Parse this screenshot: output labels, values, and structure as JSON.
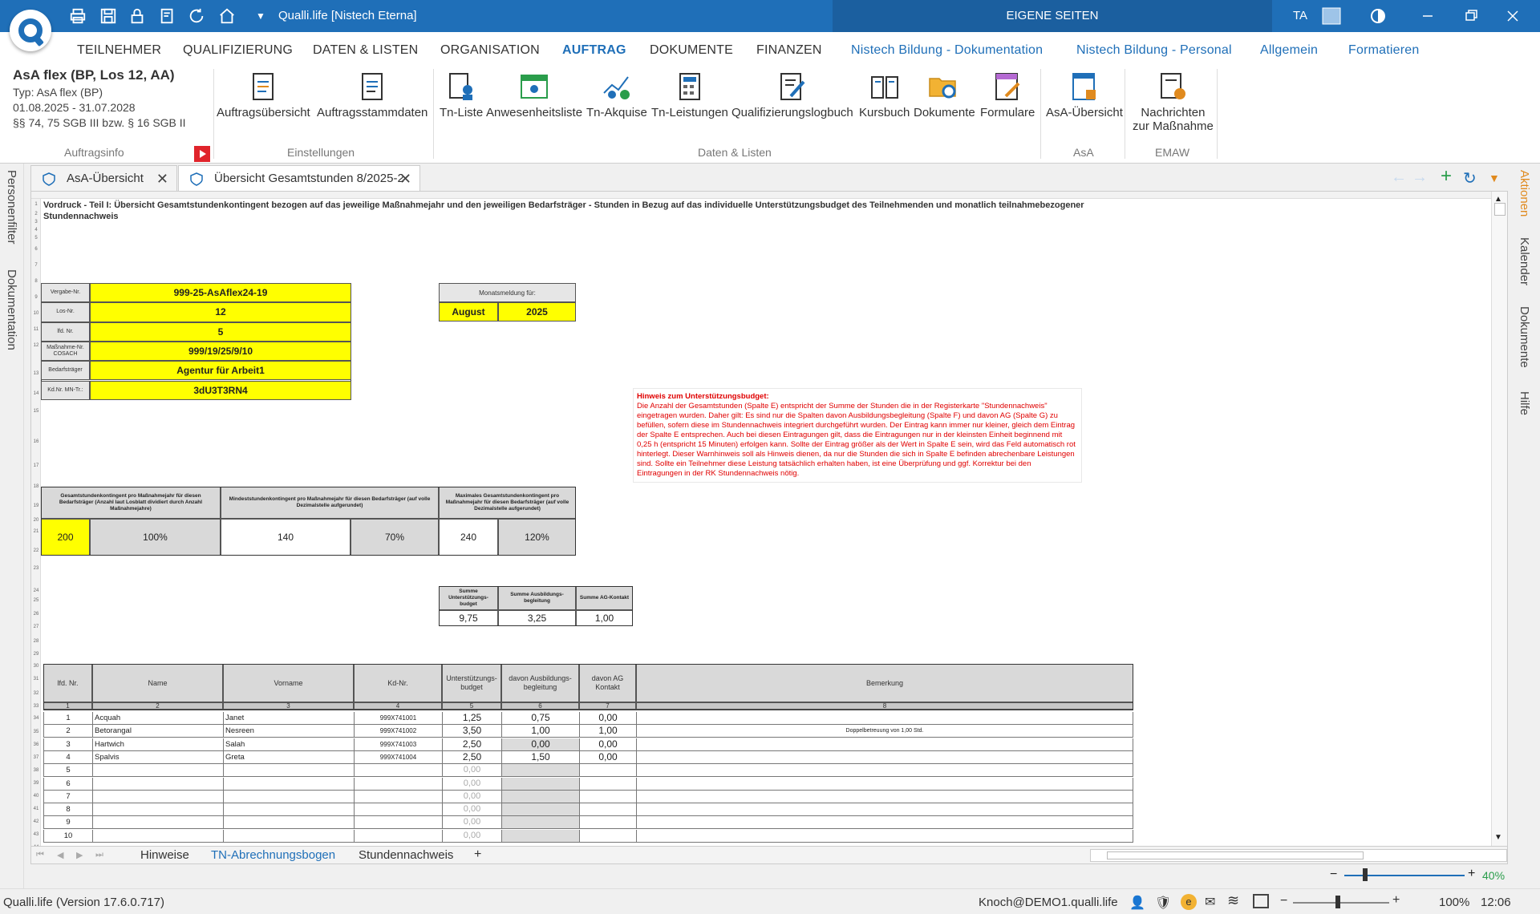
{
  "window": {
    "title": "Qualli.life [Nistech Eterna]",
    "eigene_seiten": "EIGENE SEITEN",
    "ta": "TA"
  },
  "ribbon_tabs": [
    "TEILNEHMER",
    "QUALIFIZIERUNG",
    "DATEN & LISTEN",
    "ORGANISATION",
    "AUFTRAG",
    "DOKUMENTE",
    "FINANZEN",
    "Nistech Bildung - Dokumentation",
    "Nistech Bildung - Personal",
    "Allgemein",
    "Formatieren"
  ],
  "auftragsinfo": {
    "title": "AsA flex (BP, Los 12, AA)",
    "typ": "Typ: AsA flex (BP)",
    "zeitraum": "01.08.2025 - 31.07.2028",
    "paragraph": "§§ 74, 75 SGB III bzw. § 16 SGB II",
    "group_label": "Auftragsinfo"
  },
  "groups": {
    "einstellungen": "Einstellungen",
    "daten_listen": "Daten & Listen",
    "asa": "AsA",
    "emaw": "EMAW"
  },
  "ribbon_buttons": {
    "auftragsuebersicht": "Auftragsübersicht",
    "auftragsstammdaten": "Auftragsstammdaten",
    "tn_liste": "Tn-Liste",
    "anwesenheitsliste": "Anwesenheitsliste",
    "tn_akquise": "Tn-Akquise",
    "tn_leistungen": "Tn-Leistungen",
    "qualifizierungslogbuch": "Qualifizierungslogbuch",
    "kursbuch": "Kursbuch",
    "dokumente": "Dokumente",
    "formulare": "Formulare",
    "asa_uebersicht": "AsA-Übersicht",
    "nachrichten_1": "Nachrichten",
    "nachrichten_2": "zur Maßnahme"
  },
  "left_panel": [
    "Personenfilter",
    "Dokumentation"
  ],
  "right_panel": [
    "Aktionen",
    "Kalender",
    "Dokumente",
    "Hilfe"
  ],
  "doc_tabs": [
    "AsA-Übersicht",
    "Übersicht Gesamtstunden 8/2025-2"
  ],
  "sheet": {
    "heading": "Vordruck - Teil I: Übersicht Gesamtstundenkontingent bezogen auf das jeweilige Maßnahmejahr und den jeweiligen Bedarfsträger - Stunden in Bezug auf das individuelle Unterstützungsbudget des Teilnehmenden und monatlich teilnahmebezogener Stundennachweis",
    "info_table": [
      {
        "label": "Vergabe-Nr.",
        "value": "999-25-AsAflex24-19"
      },
      {
        "label": "Los-Nr.",
        "value": "12"
      },
      {
        "label": "lfd. Nr.",
        "value": "5"
      },
      {
        "label": "Maßnahme-Nr. COSACH",
        "value": "999/19/25/9/10"
      },
      {
        "label": "Bedarfsträger",
        "value": "Agentur für Arbeit1"
      },
      {
        "label": "Kd.Nr. MN-Tr.:",
        "value": "3dU3T3RN4"
      }
    ],
    "monatsmeldung": {
      "label": "Monatsmeldung für:",
      "month": "August",
      "year": "2025"
    },
    "kontingent": {
      "h1": "Gesamtstundenkontingent pro Maßnahmejahr für diesen Bedarfsträger (Anzahl laut Losblatt dividiert durch Anzahl Maßnahmejahre)",
      "h2": "Mindeststundenkontingent pro Maßnahmejahr für diesen Bedarfsträger (auf volle Dezimalstelle aufgerundet)",
      "h3": "Maximales Gesamtstundenkontingent pro Maßnahmejahr für diesen Bedarfsträger (auf volle Dezimalstelle aufgerundet)",
      "v1": "200",
      "p1": "100%",
      "v2": "140",
      "p2": "70%",
      "v3": "240",
      "p3": "120%"
    },
    "summen": {
      "h1": "Summe Unterstützungs-budget",
      "h2": "Summe Ausbildungs-begleitung",
      "h3": "Summe AG-Kontakt",
      "v1": "9,75",
      "v2": "3,25",
      "v3": "1,00"
    },
    "hinweis": {
      "title": "Hinweis zum Unterstützungsbudget:",
      "text": "Die Anzahl der Gesamtstunden (Spalte E) entspricht der Summe der Stunden die in der Registerkarte \"Stundennachweis\" eingetragen wurden. Daher gilt: Es sind nur die Spalten davon Ausbildungsbegleitung (Spalte F) und davon AG (Spalte G) zu befüllen, sofern diese im Stundennachweis integriert durchgeführt wurden. Der Eintrag kann immer nur kleiner, gleich dem Eintrag der Spalte E entsprechen. Auch bei diesen Eintragungen gilt, dass die Eintragungen nur in der kleinsten Einheit beginnend mit 0,25 h (entspricht 15 Minuten) erfolgen kann. Sollte der Eintrag größer als der Wert in Spalte E sein, wird das Feld automatisch rot hinterlegt. Dieser Warnhinweis soll als Hinweis dienen, da nur die Stunden die sich in Spalte E befinden abrechenbare Leistungen sind. Sollte ein Teilnehmer diese Leistung tatsächlich erhalten haben, ist eine Überprüfung und ggf. Korrektur bei den Eintragungen in der RK Stundennachweis nötig."
    },
    "table": {
      "headers": [
        "lfd. Nr.",
        "Name",
        "Vorname",
        "Kd-Nr.",
        "Unterstützungs-budget",
        "davon Ausbildungs-begleitung",
        "davon AG Kontakt",
        "Bemerkung"
      ],
      "numbers": [
        "1",
        "2",
        "3",
        "4",
        "5",
        "6",
        "7",
        "8"
      ],
      "rows": [
        {
          "nr": "1",
          "name": "Acquah",
          "vorname": "Janet",
          "kd": "999X741001",
          "ub": "1,25",
          "ab": "0,75",
          "ag": "0,00",
          "bem": ""
        },
        {
          "nr": "2",
          "name": "Betorangal",
          "vorname": "Nesreen",
          "kd": "999X741002",
          "ub": "3,50",
          "ab": "1,00",
          "ag": "1,00",
          "bem": "Doppelbetreuung von 1,00 Std."
        },
        {
          "nr": "3",
          "name": "Hartwich",
          "vorname": "Salah",
          "kd": "999X741003",
          "ub": "2,50",
          "ab": "0,00",
          "ag": "0,00",
          "bem": ""
        },
        {
          "nr": "4",
          "name": "Spalvis",
          "vorname": "Greta",
          "kd": "999X741004",
          "ub": "2,50",
          "ab": "1,50",
          "ag": "0,00",
          "bem": ""
        },
        {
          "nr": "5",
          "name": "",
          "vorname": "",
          "kd": "",
          "ub": "0,00",
          "ab": "",
          "ag": "",
          "bem": ""
        },
        {
          "nr": "6",
          "name": "",
          "vorname": "",
          "kd": "",
          "ub": "0,00",
          "ab": "",
          "ag": "",
          "bem": ""
        },
        {
          "nr": "7",
          "name": "",
          "vorname": "",
          "kd": "",
          "ub": "0,00",
          "ab": "",
          "ag": "",
          "bem": ""
        },
        {
          "nr": "8",
          "name": "",
          "vorname": "",
          "kd": "",
          "ub": "0,00",
          "ab": "",
          "ag": "",
          "bem": ""
        },
        {
          "nr": "9",
          "name": "",
          "vorname": "",
          "kd": "",
          "ub": "0,00",
          "ab": "",
          "ag": "",
          "bem": ""
        },
        {
          "nr": "10",
          "name": "",
          "vorname": "",
          "kd": "",
          "ub": "0,00",
          "ab": "",
          "ag": "",
          "bem": ""
        }
      ]
    }
  },
  "sheet_tabs": [
    "Hinweise",
    "TN-Abrechnungsbogen",
    "Stundennachweis"
  ],
  "zoom": {
    "sheet": "40%",
    "app": "100%"
  },
  "status": {
    "version": "Qualli.life (Version 17.6.0.717)",
    "user": "Knoch@DEMO1.qualli.life",
    "time": "12:06"
  },
  "colors": {
    "primary": "#1f6fb8",
    "highlight": "#ffff00",
    "warning": "#e00000"
  }
}
